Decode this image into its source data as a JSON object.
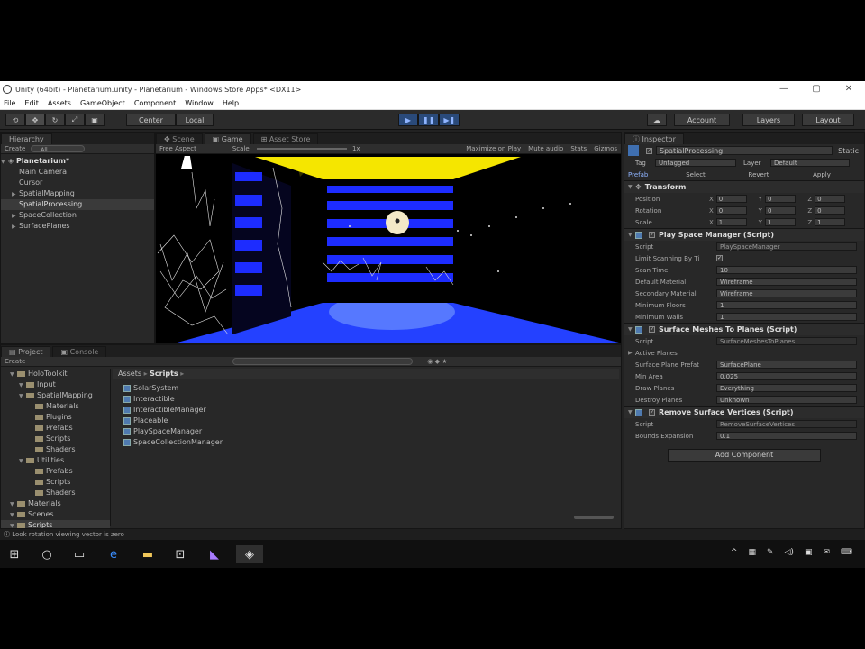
{
  "window": {
    "title": "Unity (64bit) - Planetarium.unity - Planetarium - Windows Store Apps* <DX11>",
    "controls": [
      "—",
      "▢",
      "✕"
    ]
  },
  "menu": [
    "File",
    "Edit",
    "Assets",
    "GameObject",
    "Component",
    "Window",
    "Help"
  ],
  "toolbar": {
    "tools": [
      "⟲",
      "✥",
      "↻",
      "⤢",
      "▣"
    ],
    "pivot": "Center",
    "space": "Local",
    "play": [
      "▶",
      "❚❚",
      "▶❚"
    ],
    "cloud": "☁",
    "account": "Account",
    "layers": "Layers",
    "layout": "Layout"
  },
  "hierarchy": {
    "tab": "Hierarchy",
    "create": "Create",
    "search": "All",
    "scene": "Planetarium*",
    "items": [
      "Main Camera",
      "Cursor",
      "SpatialMapping",
      "SpatialProcessing",
      "SpaceCollection",
      "SurfacePlanes"
    ]
  },
  "scene_tabs": {
    "scene": "Scene",
    "game": "Game",
    "asset_store": "Asset Store",
    "aspect": "Free Aspect",
    "scale_label": "Scale",
    "scale_value": "1x",
    "maximize": "Maximize on Play",
    "mute": "Mute audio",
    "stats": "Stats",
    "gizmos": "Gizmos"
  },
  "project": {
    "tab": "Project",
    "console_tab": "Console",
    "create": "Create",
    "tree": [
      {
        "label": "HoloToolkit",
        "indent": 1
      },
      {
        "label": "Input",
        "indent": 2
      },
      {
        "label": "SpatialMapping",
        "indent": 2
      },
      {
        "label": "Materials",
        "indent": 3
      },
      {
        "label": "Plugins",
        "indent": 3
      },
      {
        "label": "Prefabs",
        "indent": 3
      },
      {
        "label": "Scripts",
        "indent": 3
      },
      {
        "label": "Shaders",
        "indent": 3
      },
      {
        "label": "Utilities",
        "indent": 2
      },
      {
        "label": "Prefabs",
        "indent": 3
      },
      {
        "label": "Scripts",
        "indent": 3
      },
      {
        "label": "Shaders",
        "indent": 3
      },
      {
        "label": "Materials",
        "indent": 1
      },
      {
        "label": "Scenes",
        "indent": 1
      },
      {
        "label": "Scripts",
        "indent": 1
      }
    ],
    "breadcrumb_root": "Assets",
    "breadcrumb_current": "Scripts",
    "files": [
      "SolarSystem",
      "Interactible",
      "InteractibleManager",
      "Placeable",
      "PlaySpaceManager",
      "SpaceCollectionManager"
    ]
  },
  "inspector": {
    "tab": "Inspector",
    "object_name": "SpatialProcessing",
    "static_label": "Static",
    "tag_label": "Tag",
    "tag_value": "Untagged",
    "layer_label": "Layer",
    "layer_value": "Default",
    "prefab_label": "Prefab",
    "prefab_buttons": [
      "Select",
      "Revert",
      "Apply"
    ],
    "transform": {
      "title": "Transform",
      "rows": [
        {
          "label": "Position",
          "x": "0",
          "y": "0",
          "z": "0"
        },
        {
          "label": "Rotation",
          "x": "0",
          "y": "0",
          "z": "0"
        },
        {
          "label": "Scale",
          "x": "1",
          "y": "1",
          "z": "1"
        }
      ]
    },
    "play_space": {
      "title": "Play Space Manager (Script)",
      "rows": [
        {
          "label": "Script",
          "value": "PlaySpaceManager"
        },
        {
          "label": "Limit Scanning By Ti",
          "value": "✓"
        },
        {
          "label": "Scan Time",
          "value": "10"
        },
        {
          "label": "Default Material",
          "value": "Wireframe"
        },
        {
          "label": "Secondary Material",
          "value": "Wireframe"
        },
        {
          "label": "Minimum Floors",
          "value": "1"
        },
        {
          "label": "Minimum Walls",
          "value": "1"
        }
      ]
    },
    "surface_meshes": {
      "title": "Surface Meshes To Planes (Script)",
      "rows": [
        {
          "label": "Script",
          "value": "SurfaceMeshesToPlanes"
        },
        {
          "label": "Active Planes",
          "value": ""
        },
        {
          "label": "Surface Plane Prefat",
          "value": "SurfacePlane"
        },
        {
          "label": "Min Area",
          "value": "0.025"
        },
        {
          "label": "Draw Planes",
          "value": "Everything"
        },
        {
          "label": "Destroy Planes",
          "value": "Unknown"
        }
      ]
    },
    "remove_vertices": {
      "title": "Remove Surface Vertices (Script)",
      "rows": [
        {
          "label": "Script",
          "value": "RemoveSurfaceVertices"
        },
        {
          "label": "Bounds Expansion",
          "value": "0.1"
        }
      ]
    },
    "add_component": "Add Component"
  },
  "status": "Look rotation viewing vector is zero",
  "taskbar": {
    "icons": [
      "windows-start-icon",
      "search-circle-icon",
      "task-view-icon",
      "edge-icon",
      "file-explorer-icon",
      "store-icon",
      "visual-studio-icon",
      "unity-icon"
    ],
    "tray": [
      "^",
      "▦",
      "✎",
      "◁)",
      "▣",
      "✉",
      "⌨"
    ]
  },
  "colors": {
    "accent": "#2a4a7a",
    "scene_yellow": "#f5e600",
    "scene_blue": "#1f3dff",
    "panel_bg": "#282828"
  }
}
